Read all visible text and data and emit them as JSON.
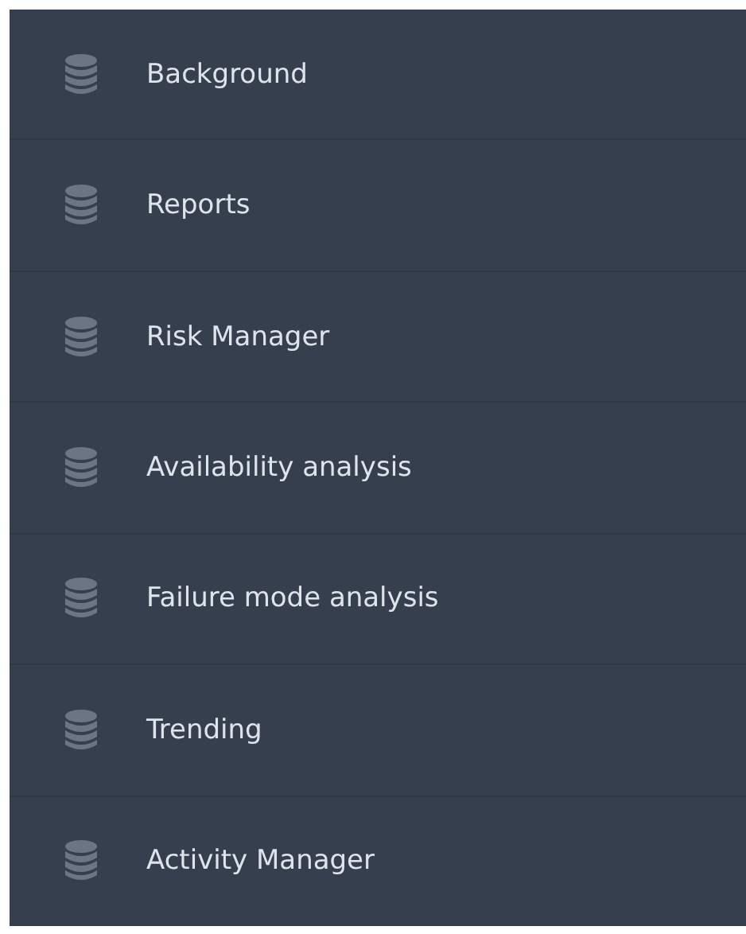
{
  "sidebar": {
    "items": [
      {
        "label": "Background"
      },
      {
        "label": "Reports"
      },
      {
        "label": "Risk Manager"
      },
      {
        "label": "Availability analysis"
      },
      {
        "label": "Failure mode analysis"
      },
      {
        "label": "Trending"
      },
      {
        "label": "Activity Manager"
      }
    ]
  }
}
